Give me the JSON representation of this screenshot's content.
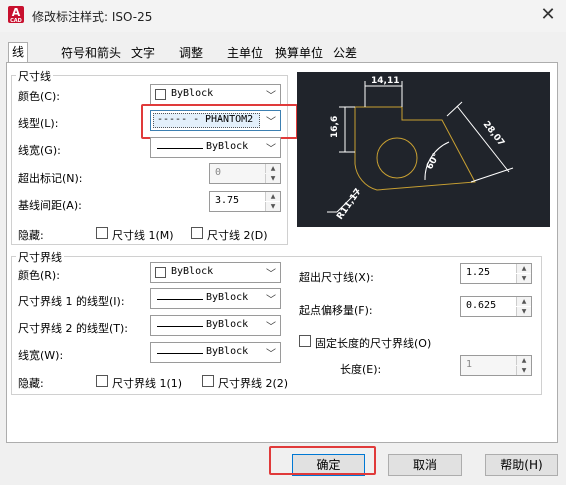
{
  "window": {
    "title": "修改标注样式: ISO-25",
    "close_glyph": "✕",
    "app_letter": "A",
    "app_small": "CAD"
  },
  "tabs": [
    "线",
    "符号和箭头",
    "文字",
    "调整",
    "主单位",
    "换算单位",
    "公差"
  ],
  "dim_lines": {
    "group_title": "尺寸线",
    "color": {
      "label": "颜色(C):",
      "value": "ByBlock"
    },
    "linetype": {
      "label": "线型(L):",
      "value": "PHANTOM2",
      "prefix": "----- - - -"
    },
    "lineweight": {
      "label": "线宽(G):",
      "value": "ByBlock"
    },
    "extend": {
      "label": "超出标记(N):",
      "value": "0"
    },
    "baseline": {
      "label": "基线间距(A):",
      "value": "3.75"
    },
    "suppress": {
      "label": "隐藏:",
      "opt1": "尺寸线 1(M)",
      "opt2": "尺寸线 2(D)"
    }
  },
  "ext_lines": {
    "group_title": "尺寸界线",
    "color": {
      "label": "颜色(R):",
      "value": "ByBlock"
    },
    "lt1": {
      "label": "尺寸界线 1 的线型(I):",
      "value": "ByBlock"
    },
    "lt2": {
      "label": "尺寸界线 2 的线型(T):",
      "value": "ByBlock"
    },
    "lineweight": {
      "label": "线宽(W):",
      "value": "ByBlock"
    },
    "suppress": {
      "label": "隐藏:",
      "opt1": "尺寸界线 1(1)",
      "opt2": "尺寸界线 2(2)"
    },
    "extend": {
      "label": "超出尺寸线(X):",
      "value": "1.25"
    },
    "offset": {
      "label": "起点偏移量(F):",
      "value": "0.625"
    },
    "fixed": {
      "label": "固定长度的尺寸界线(O)"
    },
    "length": {
      "label": "长度(E):",
      "value": "1"
    }
  },
  "preview": {
    "dim_top": "14,11",
    "dim_left": "16,6",
    "dim_right": "28,07",
    "dim_angle": "60°",
    "dim_radius": "R11,17",
    "line_color": "#c8a032",
    "text_color": "#ffffff",
    "bg": "#20242b"
  },
  "buttons": {
    "ok": "确定",
    "cancel": "取消",
    "help": "帮助(H)"
  },
  "colors": {
    "highlight": "#e03a3a",
    "accent": "#0078d4"
  }
}
